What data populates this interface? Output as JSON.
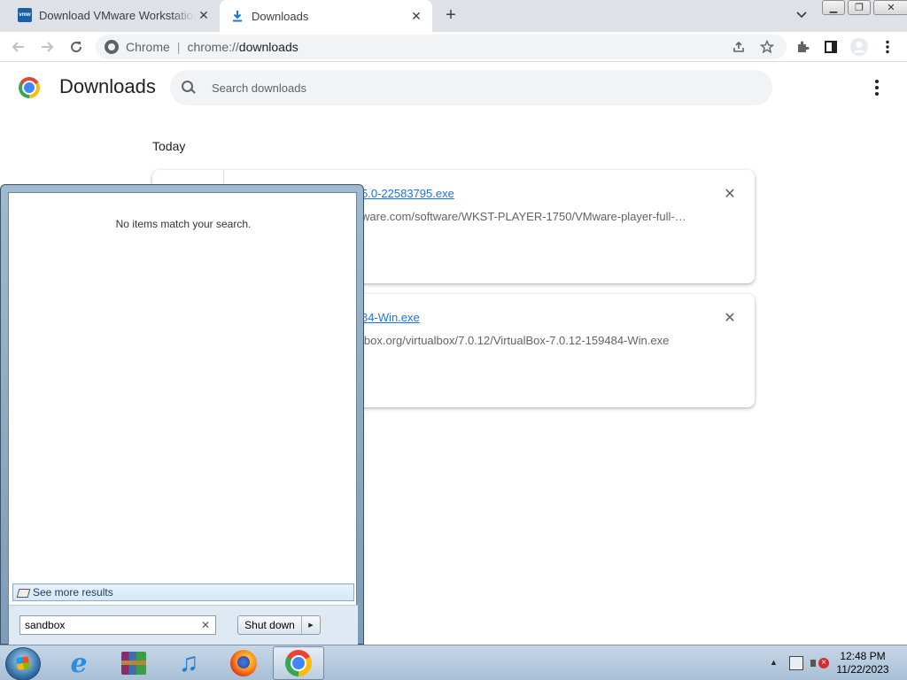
{
  "browser": {
    "tabs": [
      {
        "title": "Download VMware Workstation Pro",
        "favicon": "vmware-icon",
        "active": false
      },
      {
        "title": "Downloads",
        "favicon": "download-icon",
        "active": true
      }
    ],
    "new_tab_label": "+",
    "omnibox": {
      "site_label": "Chrome",
      "url_scheme": "chrome://",
      "url_host": "downloads"
    }
  },
  "downloads_page": {
    "title": "Downloads",
    "search_placeholder": "Search downloads",
    "section_label": "Today",
    "items": [
      {
        "name_visible": "5.0-22583795.exe",
        "url_visible": "ware.com/software/WKST-PLAYER-1750/VMware-player-full-1..."
      },
      {
        "name_visible": "84-Win.exe",
        "url_visible": "lbox.org/virtualbox/7.0.12/VirtualBox-7.0.12-159484-Win.exe"
      }
    ]
  },
  "start_menu": {
    "no_results_text": "No items match your search.",
    "see_more_label": "See more results",
    "search_value": "sandbox",
    "shutdown_label": "Shut down"
  },
  "taskbar": {
    "pinned": [
      "internet-explorer-icon",
      "winrar-icon",
      "itunes-icon",
      "firefox-icon",
      "chrome-icon"
    ],
    "clock_time": "12:48 PM",
    "clock_date": "11/22/2023"
  },
  "colors": {
    "link": "#1a73e8",
    "tabstrip": "#dee1e6",
    "taskbar": "#b8cbe0"
  }
}
